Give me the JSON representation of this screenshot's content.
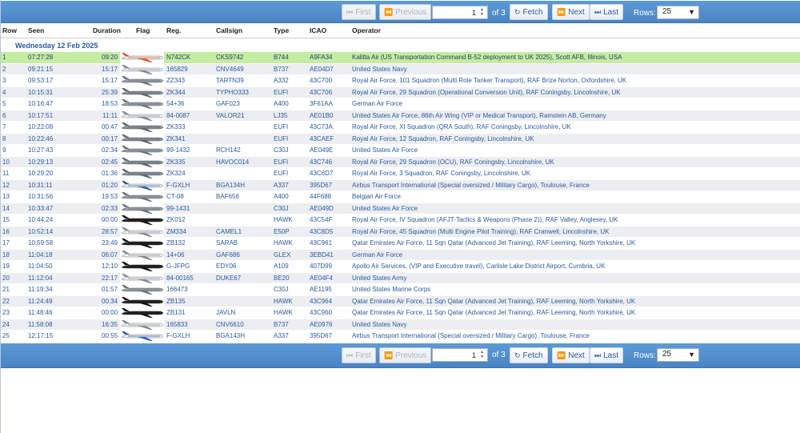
{
  "pager": {
    "first": "First",
    "previous": "Previous",
    "page": "1",
    "of_label": "of 3",
    "fetch": "Fetch",
    "next": "Next",
    "last": "Last",
    "rows_label": "Rows:",
    "rows_value": "25"
  },
  "columns": {
    "row": "Row",
    "seen": "Seen",
    "duration": "Duration",
    "flag": "Flag",
    "reg": "Reg.",
    "callsign": "Callsign",
    "type": "Type",
    "icao": "ICAO",
    "operator": "Operator"
  },
  "group_label": "Wednesday 12 Feb 2025",
  "colors": {
    "accent": "#4a84c4",
    "highlight": "#c4eda2",
    "link": "#2b5aa0"
  },
  "rows": [
    {
      "row": "1",
      "seen": "07:27:28",
      "duration": "09:20",
      "reg": "N742CK",
      "callsign": "CKS9742",
      "type": "B744",
      "icao": "A9FA34",
      "operator": "Kalitta Air (US Transportation Command B-52 deployment to UK 2025), Scott AFB, Illinois, USA",
      "livery": "orange"
    },
    {
      "row": "2",
      "seen": "09:21:15",
      "duration": "15:17",
      "reg": "165829",
      "callsign": "CNV4649",
      "type": "B737",
      "icao": "AE04D7",
      "operator": "United States Navy",
      "livery": "white"
    },
    {
      "row": "3",
      "seen": "09:53:17",
      "duration": "15:17",
      "reg": "ZZ343",
      "callsign": "TARTN39",
      "type": "A332",
      "icao": "43C700",
      "operator": "Royal Air Force, 101 Squadron (Multi Role Tanker Transport), RAF Brize Norton, Oxfordshire, UK",
      "livery": "grey"
    },
    {
      "row": "4",
      "seen": "10:15:31",
      "duration": "25:39",
      "reg": "ZK344",
      "callsign": "TYPHO333",
      "type": "EUFI",
      "icao": "43C706",
      "operator": "Royal Air Force, 29 Squadron (Operational Conversion Unit), RAF Coningsby, Lincolnshire, UK",
      "livery": "jet"
    },
    {
      "row": "5",
      "seen": "10:16:47",
      "duration": "18:53",
      "reg": "54+36",
      "callsign": "GAF023",
      "type": "A400",
      "icao": "3F61AA",
      "operator": "German Air Force",
      "livery": "grey"
    },
    {
      "row": "6",
      "seen": "10:17:51",
      "duration": "11:11",
      "reg": "84-0087",
      "callsign": "VALOR21",
      "type": "LJ35",
      "icao": "AE01B0",
      "operator": "United States Air Force, 86th Air Wing (VIP or Medical Transport), Ramstein AB, Germany",
      "livery": "white"
    },
    {
      "row": "7",
      "seen": "10:22:08",
      "duration": "00:47",
      "reg": "ZK333",
      "callsign": "",
      "type": "EUFI",
      "icao": "43C73A",
      "operator": "Royal Air Force, XI Squadron (QRA South), RAF Coningsby, Lincolnshire, UK",
      "livery": "jet"
    },
    {
      "row": "8",
      "seen": "10:22:46",
      "duration": "00:17",
      "reg": "ZK341",
      "callsign": "",
      "type": "EUFI",
      "icao": "43CAEF",
      "operator": "Royal Air Force, 12 Squadron, RAF Coningsby, Lincolnshire, UK",
      "livery": "jet"
    },
    {
      "row": "9",
      "seen": "10:27:43",
      "duration": "02:34",
      "reg": "99-1432",
      "callsign": "RCH142",
      "type": "C30J",
      "icao": "AE049E",
      "operator": "United States Air Force",
      "livery": "grey"
    },
    {
      "row": "10",
      "seen": "10:29:13",
      "duration": "02:45",
      "reg": "ZK335",
      "callsign": "HAVOC014",
      "type": "EUFI",
      "icao": "43C746",
      "operator": "Royal Air Force, 29 Squadron (OCU), RAF Coningsby, Lincolnshire, UK",
      "livery": "jet"
    },
    {
      "row": "11",
      "seen": "10:29:20",
      "duration": "01:36",
      "reg": "ZK324",
      "callsign": "",
      "type": "EUFI",
      "icao": "43C6D7",
      "operator": "Royal Air Force, 3 Squadron, RAF Coningsby, Lincolnshire, UK",
      "livery": "jet"
    },
    {
      "row": "12",
      "seen": "10:31:11",
      "duration": "01:20",
      "reg": "F-GXLH",
      "callsign": "BGA134H",
      "type": "A337",
      "icao": "395D67",
      "operator": "Airbus Transport International (Special oversized / Military Cargo), Toulouse, France",
      "livery": "blue"
    },
    {
      "row": "13",
      "seen": "10:31:56",
      "duration": "19:53",
      "reg": "CT-08",
      "callsign": "BAF656",
      "type": "A400",
      "icao": "44F688",
      "operator": "Belgian Air Force",
      "livery": "grey"
    },
    {
      "row": "14",
      "seen": "10:33:47",
      "duration": "02:33",
      "reg": "99-1431",
      "callsign": "",
      "type": "C30J",
      "icao": "AE049D",
      "operator": "United States Air Force",
      "livery": "grey"
    },
    {
      "row": "15",
      "seen": "10:44:24",
      "duration": "00:00",
      "reg": "ZK012",
      "callsign": "",
      "type": "HAWK",
      "icao": "43C54F",
      "operator": "Royal Air Force, IV Squadron (AFJT-Tactics & Weapons (Phase 2)), RAF Valley, Anglesey, UK",
      "livery": "black"
    },
    {
      "row": "16",
      "seen": "10:52:14",
      "duration": "28:57",
      "reg": "ZM334",
      "callsign": "CAMEL1",
      "type": "E50P",
      "icao": "43C8D5",
      "operator": "Royal Air Force, 45 Squadron (Multi Engine Pilot Training), RAF Cranwell, Lincolnshire, UK",
      "livery": "white"
    },
    {
      "row": "17",
      "seen": "10:59:58",
      "duration": "23:49",
      "reg": "ZB132",
      "callsign": "SARAB",
      "type": "HAWK",
      "icao": "43C961",
      "operator": "Qatar Emirates Air Force, 11 Sqn Qatar (Advanced Jet Training), RAF Leeming, North Yorkshire, UK",
      "livery": "black"
    },
    {
      "row": "18",
      "seen": "11:04:18",
      "duration": "06:07",
      "reg": "14+06",
      "callsign": "GAF686",
      "type": "GLEX",
      "icao": "3EBD41",
      "operator": "German Air Force",
      "livery": "white"
    },
    {
      "row": "19",
      "seen": "11:04:50",
      "duration": "12:10",
      "reg": "G-JFPG",
      "callsign": "EDY06",
      "type": "A109",
      "icao": "407D99",
      "operator": "Apollo Air Services, (VIP and Executive travel), Carlisle Lake District Airport, Cumbria, UK",
      "livery": "black"
    },
    {
      "row": "20",
      "seen": "11:12:04",
      "duration": "22:17",
      "reg": "84-00165",
      "callsign": "DUKE67",
      "type": "BE20",
      "icao": "AE04F4",
      "operator": "United States Army",
      "livery": "white"
    },
    {
      "row": "21",
      "seen": "11:19:34",
      "duration": "01:57",
      "reg": "166473",
      "callsign": "",
      "type": "C30J",
      "icao": "AE1195",
      "operator": "United States Marine Corps",
      "livery": "grey"
    },
    {
      "row": "22",
      "seen": "11:24:49",
      "duration": "00:34",
      "reg": "ZB135",
      "callsign": "",
      "type": "HAWK",
      "icao": "43C964",
      "operator": "Qatar Emirates Air Force, 11 Sqn Qatar (Advanced Jet Training), RAF Leeming, North Yorkshire, UK",
      "livery": "black"
    },
    {
      "row": "23",
      "seen": "11:48:46",
      "duration": "00:00",
      "reg": "ZB131",
      "callsign": "JAVLN",
      "type": "HAWK",
      "icao": "43C960",
      "operator": "Qatar Emirates Air Force, 11 Sqn Qatar (Advanced Jet Training), RAF Leeming, North Yorkshire, UK",
      "livery": "black"
    },
    {
      "row": "24",
      "seen": "11:58:08",
      "duration": "16:35",
      "reg": "165833",
      "callsign": "CNV6610",
      "type": "B737",
      "icao": "AE0976",
      "operator": "United States Navy",
      "livery": "white"
    },
    {
      "row": "25",
      "seen": "12:17:15",
      "duration": "00:55",
      "reg": "F-GXLH",
      "callsign": "BGA143H",
      "type": "A337",
      "icao": "395D67",
      "operator": "Airbus Transport International (Special oversized / Military Cargo), Toulouse, France",
      "livery": "blue"
    }
  ]
}
